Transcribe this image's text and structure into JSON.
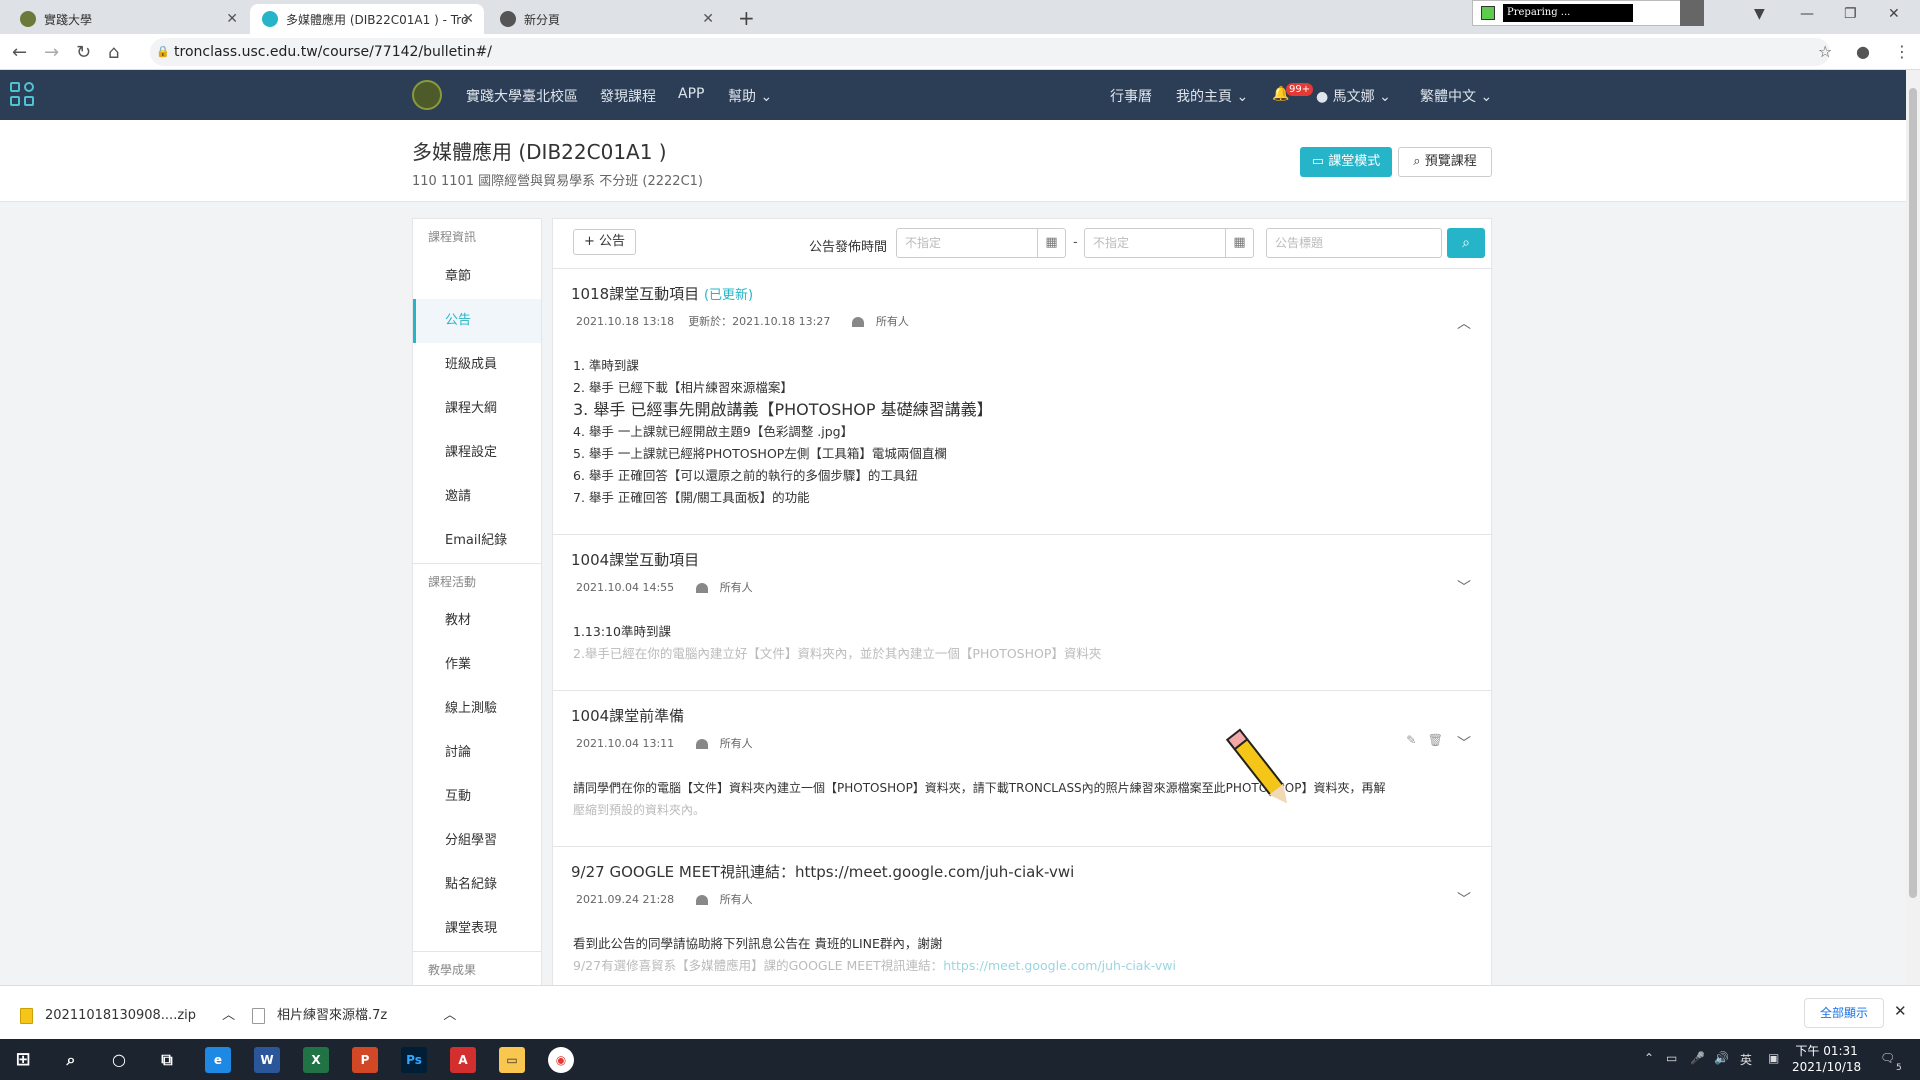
{
  "browser": {
    "tabs": [
      {
        "title": "實踐大學"
      },
      {
        "title": "多媒體應用 (DIB22C01A1 ) - Tro"
      },
      {
        "title": "新分頁"
      }
    ],
    "preparing": "Preparing ...",
    "url": "tronclass.usc.edu.tw/course/77142/bulletin#/"
  },
  "topnav": {
    "campus": "實踐大學臺北校區",
    "discover": "發現課程",
    "app": "APP",
    "help": "幫助",
    "calendar": "行事曆",
    "home": "我的主頁",
    "badge": "99+",
    "user": "馬文娜",
    "lang": "繁體中文"
  },
  "course": {
    "title": "多媒體應用 (DIB22C01A1 )",
    "subtitle": "110 1101 國際經營與貿易學系 不分班 (2222C1)",
    "class_mode": "課堂模式",
    "preview": "預覽課程"
  },
  "sidebar": {
    "sec1": "課程資訊",
    "items1": [
      "章節",
      "公告",
      "班級成員",
      "課程大綱",
      "課程設定",
      "邀請",
      "Email紀錄"
    ],
    "sec2": "課程活動",
    "items2": [
      "教材",
      "作業",
      "線上測驗",
      "討論",
      "互動",
      "分組學習",
      "點名紀錄",
      "課堂表現"
    ],
    "sec3": "教學成果"
  },
  "toolbar": {
    "add": "+ 公告",
    "filter_label": "公告發佈時間",
    "date_from_placeholder": "不指定",
    "date_to_placeholder": "不指定",
    "title_placeholder": "公告標題"
  },
  "announcements": [
    {
      "title": "1018課堂互動項目",
      "updated": "(已更新)",
      "time": "2021.10.18 13:18",
      "update_time": "更新於：2021.10.18 13:27",
      "audience": "所有人",
      "lines": [
        "1. 準時到課",
        "2. 舉手 已經下載【相片練習來源檔案】",
        "3. 舉手 已經事先開啟講義【PHOTOSHOP 基礎練習講義】",
        "4. 舉手 一上課就已經開啟主題9【色彩調整 .jpg】",
        "5. 舉手 一上課就已經將PHOTOSHOP左側【工具箱】電城兩個直欄",
        "6. 舉手 正確回答【可以還原之前的執行的多個步驟】的工具鈕",
        "7. 舉手 正確回答【開/關工具面板】的功能"
      ]
    },
    {
      "title": "1004課堂互動項目",
      "time": "2021.10.04 14:55",
      "audience": "所有人",
      "lines": [
        "1.13:10準時到課",
        "2.舉手已經在你的電腦內建立好【文件】資料夾內，並於其內建立一個【PHOTOSHOP】資料夾"
      ]
    },
    {
      "title": "1004課堂前準備",
      "time": "2021.10.04 13:11",
      "audience": "所有人",
      "lines": [
        "請同學們在你的電腦【文件】資料夾內建立一個【PHOTOSHOP】資料夾，請下載TRONCLASS內的照片練習來源檔案至此PHOTOSHOP】資料夾，再解",
        "壓縮到預設的資料夾內。"
      ]
    },
    {
      "title": "9/27 GOOGLE MEET視訊連結：https://meet.google.com/juh-ciak-vwi",
      "time": "2021.09.24 21:28",
      "audience": "所有人",
      "lines": [
        "看到此公告的同學請協助將下列訊息公告在 貴班的LINE群內，謝謝",
        "9/27有選修喜貿系【多媒體應用】課的GOOGLE MEET視訊連結："
      ],
      "link": "https://meet.google.com/juh-ciak-vwi"
    }
  ],
  "downloads": [
    {
      "name": "20211018130908....zip"
    },
    {
      "name": "相片練習來源檔.7z"
    }
  ],
  "showall": "全部顯示",
  "clock": {
    "time": "下午 01:31",
    "date": "2021/10/18"
  },
  "ime": "英",
  "notif_count": "5"
}
